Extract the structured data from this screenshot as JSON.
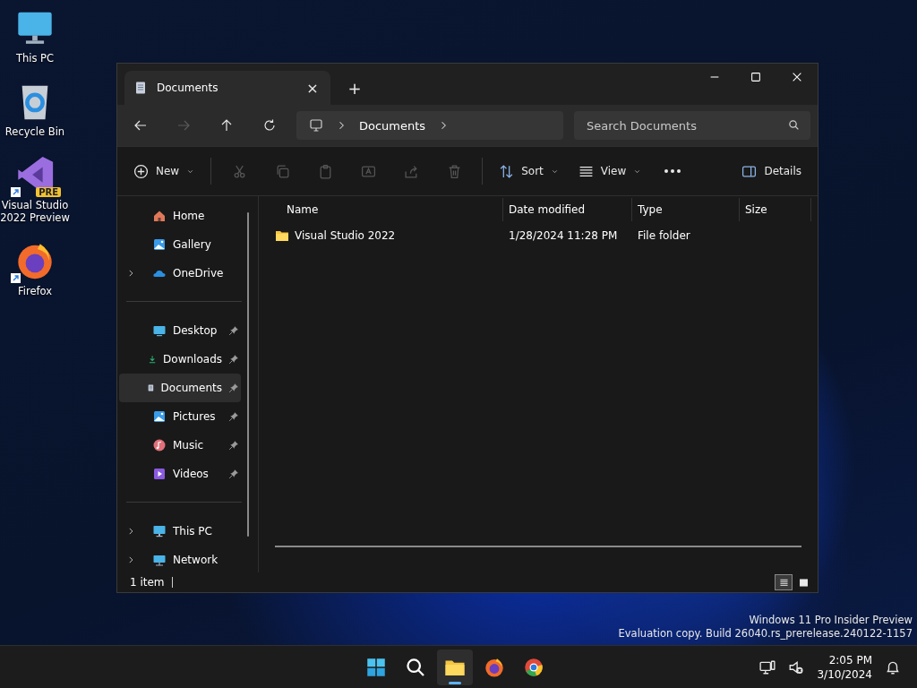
{
  "desktop_icons": [
    {
      "label": "This PC"
    },
    {
      "label": "Recycle Bin"
    },
    {
      "label": "Visual Studio 2022 Preview",
      "badge": "PRE",
      "shortcut": true
    },
    {
      "label": "Firefox",
      "shortcut": true
    }
  ],
  "window": {
    "tabs": [
      {
        "title": "Documents",
        "selected": true,
        "close": "×"
      }
    ],
    "new_tab": "+",
    "nav_buttons": [
      {
        "disabled": false
      },
      {
        "disabled": true
      },
      {
        "disabled": false
      },
      {
        "disabled": false
      }
    ],
    "breadcrumb": [
      "Documents"
    ],
    "search": {
      "placeholder": "Search Documents"
    },
    "toolbar": [
      {
        "kind": "menu",
        "label": "New",
        "disabled": false
      },
      {
        "kind": "sep"
      },
      {
        "kind": "icon",
        "disabled": true
      },
      {
        "kind": "icon",
        "disabled": true
      },
      {
        "kind": "icon",
        "disabled": true
      },
      {
        "kind": "icon",
        "disabled": true
      },
      {
        "kind": "icon",
        "disabled": true
      },
      {
        "kind": "icon",
        "disabled": true
      },
      {
        "kind": "sep"
      },
      {
        "kind": "menu",
        "label": "Sort",
        "disabled": false
      },
      {
        "kind": "menu",
        "label": "View",
        "disabled": false
      },
      {
        "kind": "more",
        "disabled": false
      }
    ],
    "details_button": "Details",
    "sidebar": [
      [
        {
          "label": "Home",
          "expandable": false,
          "pinned": false,
          "selected": false
        },
        {
          "label": "Gallery",
          "expandable": false,
          "pinned": false,
          "selected": false
        },
        {
          "label": "OneDrive",
          "expandable": true,
          "pinned": false,
          "selected": false
        }
      ],
      [
        {
          "label": "Desktop",
          "expandable": false,
          "pinned": true,
          "selected": false
        },
        {
          "label": "Downloads",
          "expandable": false,
          "pinned": true,
          "selected": false
        },
        {
          "label": "Documents",
          "expandable": false,
          "pinned": true,
          "selected": true
        },
        {
          "label": "Pictures",
          "expandable": false,
          "pinned": true,
          "selected": false
        },
        {
          "label": "Music",
          "expandable": false,
          "pinned": true,
          "selected": false
        },
        {
          "label": "Videos",
          "expandable": false,
          "pinned": true,
          "selected": false
        }
      ],
      [
        {
          "label": "This PC",
          "expandable": true,
          "pinned": false,
          "selected": false
        },
        {
          "label": "Network",
          "expandable": true,
          "pinned": false,
          "selected": false
        }
      ]
    ],
    "columns": [
      "Name",
      "Date modified",
      "Type",
      "Size"
    ],
    "rows": [
      {
        "name": "Visual Studio 2022",
        "date_modified": "1/28/2024 11:28 PM",
        "type": "File folder",
        "size": ""
      }
    ],
    "status": "1 item",
    "view_toggles": [
      {
        "selected": true
      },
      {
        "selected": false
      }
    ]
  },
  "watermark": [
    "Windows 11 Pro Insider Preview",
    "Evaluation copy. Build 26040.rs_prerelease.240122-1157"
  ],
  "taskbar": {
    "apps": [
      {
        "selected": false
      },
      {
        "selected": false
      },
      {
        "selected": true
      },
      {
        "selected": false
      },
      {
        "selected": false
      }
    ],
    "time": "2:05 PM",
    "date": "3/10/2024"
  }
}
